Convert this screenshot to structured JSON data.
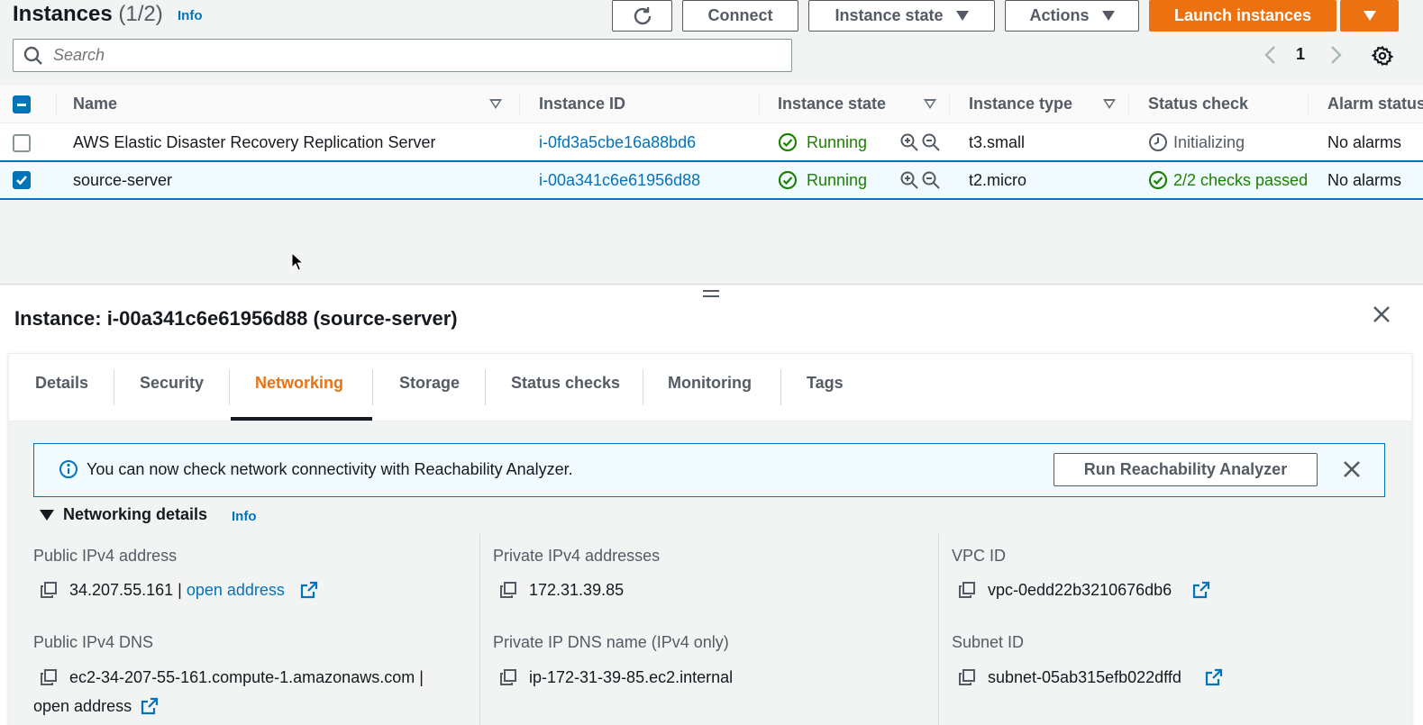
{
  "header": {
    "title": "Instances",
    "count": "(1/2)",
    "info_label": "Info",
    "connect_label": "Connect",
    "instance_state_label": "Instance state",
    "actions_label": "Actions",
    "launch_label": "Launch instances"
  },
  "search": {
    "placeholder": "Search"
  },
  "pagination": {
    "current_page": "1"
  },
  "table": {
    "columns": [
      "Name",
      "Instance ID",
      "Instance state",
      "Instance type",
      "Status check",
      "Alarm status"
    ],
    "rows": [
      {
        "name": "AWS Elastic Disaster Recovery Replication Server",
        "instance_id": "i-0fd3a5cbe16a88bd6",
        "state": "Running",
        "type": "t3.small",
        "status_check": "Initializing",
        "alarm": "No alarms",
        "selected": false
      },
      {
        "name": "source-server",
        "instance_id": "i-00a341c6e61956d88",
        "state": "Running",
        "type": "t2.micro",
        "status_check": "2/2 checks passed",
        "alarm": "No alarms",
        "selected": true
      }
    ]
  },
  "detail": {
    "title": "Instance: i-00a341c6e61956d88 (source-server)",
    "tabs": [
      "Details",
      "Security",
      "Networking",
      "Storage",
      "Status checks",
      "Monitoring",
      "Tags"
    ],
    "active_tab": "Networking",
    "alert": {
      "text": "You can now check network connectivity with Reachability Analyzer.",
      "button": "Run Reachability Analyzer"
    },
    "section_title": "Networking details",
    "section_info": "Info",
    "fields": {
      "public_ipv4_label": "Public IPv4 address",
      "public_ipv4_value": "34.207.55.161 |",
      "open_address": "open address",
      "private_ipv4_label": "Private IPv4 addresses",
      "private_ipv4_value": "172.31.39.85",
      "vpc_label": "VPC ID",
      "vpc_value": "vpc-0edd22b3210676db6",
      "public_dns_label": "Public IPv4 DNS",
      "public_dns_value": "ec2-34-207-55-161.compute-1.amazonaws.com |",
      "private_dns_label": "Private IP DNS name (IPv4 only)",
      "private_dns_value": "ip-172-31-39-85.ec2.internal",
      "subnet_label": "Subnet ID",
      "subnet_value": "subnet-05ab315efb022dffd"
    }
  },
  "colors": {
    "accent_orange": "#ec7211",
    "link_blue": "#0073bb",
    "success_green": "#1d8102",
    "text_grey": "#545b64"
  },
  "icons": [
    "refresh-icon",
    "search-icon",
    "settings-icon",
    "chevron-left-icon",
    "chevron-right-icon",
    "check-circle-icon",
    "zoom-in-icon",
    "zoom-out-icon",
    "clock-icon",
    "close-icon",
    "info-icon",
    "copy-icon",
    "external-link-icon"
  ]
}
